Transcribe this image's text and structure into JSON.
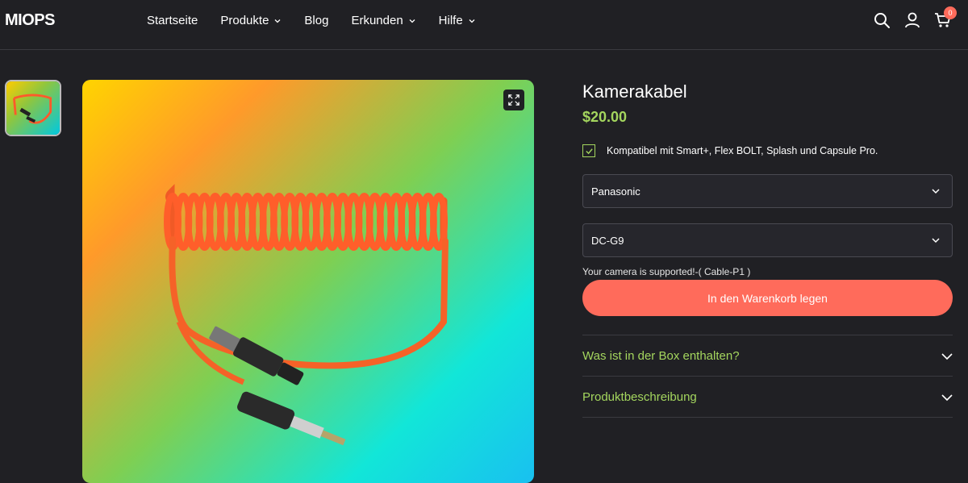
{
  "header": {
    "logo": "MIOPS",
    "nav": [
      {
        "label": "Startseite"
      },
      {
        "label": "Produkte"
      },
      {
        "label": "Blog"
      },
      {
        "label": "Erkunden"
      },
      {
        "label": "Hilfe"
      }
    ],
    "cart_count": "0"
  },
  "product": {
    "title": "Kamerakabel",
    "price": "$20.00",
    "compat_text": "Kompatibel mit Smart+, Flex BOLT, Splash und Capsule Pro.",
    "brand_select": "Panasonic",
    "model_select": "DC-G9",
    "support_text": "Your camera is supported!-( Cable-P1 )",
    "add_to_cart": "In den Warenkorb legen",
    "accordion": [
      {
        "label": "Was ist in der Box enthalten?"
      },
      {
        "label": "Produktbeschreibung"
      }
    ]
  },
  "colors": {
    "accent": "#a4d65e",
    "cta": "#ff6b5b",
    "background": "#202024"
  }
}
